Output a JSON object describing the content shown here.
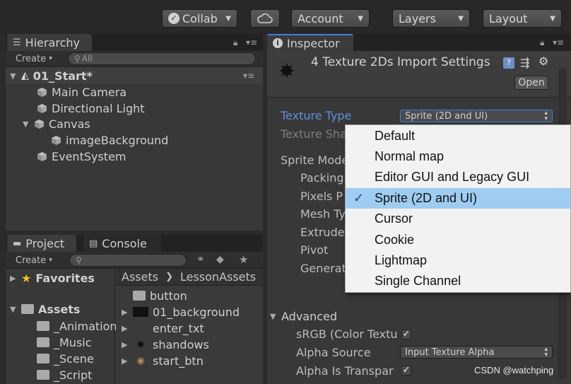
{
  "toolbar": {
    "collab": "Collab",
    "account": "Account",
    "layers": "Layers",
    "layout": "Layout"
  },
  "hierarchy": {
    "tab": "Hierarchy",
    "create": "Create",
    "search_placeholder": "All",
    "scene": "01_Start*",
    "items": [
      "Main Camera",
      "Directional Light",
      "Canvas",
      "imageBackground",
      "EventSystem"
    ]
  },
  "project": {
    "tab": "Project",
    "console_tab": "Console",
    "create": "Create",
    "favorites": "Favorites",
    "assets": "Assets",
    "folders": [
      "_Animation",
      "_Music",
      "_Scene",
      "_Script"
    ],
    "breadcrumb": [
      "Assets",
      "LessonAssets"
    ],
    "files": [
      "button",
      "01_background",
      "enter_txt",
      "shandows",
      "start_btn"
    ]
  },
  "inspector": {
    "tab": "Inspector",
    "title": "4 Texture 2Ds Import Settings",
    "open": "Open",
    "texture_type_label": "Texture Type",
    "texture_type_value": "Sprite (2D and UI)",
    "texture_shape_label": "Texture Sha",
    "sprite_mode_label": "Sprite Mode",
    "sub_labels": [
      "Packing",
      "Pixels P",
      "Mesh Ty",
      "Extrude",
      "Pivot",
      "Generat"
    ],
    "advanced": "Advanced",
    "srgb_label": "sRGB (Color Textu",
    "alpha_source_label": "Alpha Source",
    "alpha_source_value": "Input Texture Alpha",
    "alpha_transparency_label": "Alpha Is Transpar"
  },
  "menu": {
    "items": [
      "Default",
      "Normal map",
      "Editor GUI and Legacy GUI",
      "Sprite (2D and UI)",
      "Cursor",
      "Cookie",
      "Lightmap",
      "Single Channel"
    ],
    "selected_index": 3
  },
  "watermark": "CSDN @watchping"
}
